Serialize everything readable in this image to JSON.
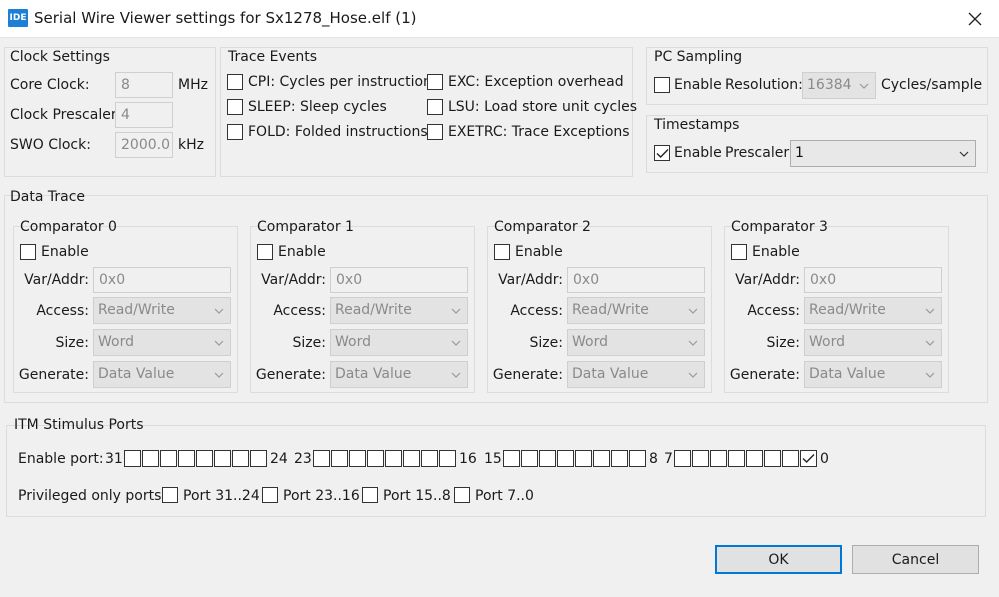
{
  "window": {
    "icon_text": "IDE",
    "title": "Serial Wire Viewer settings for Sx1278_Hose.elf (1)"
  },
  "clock_settings": {
    "title": "Clock Settings",
    "core_clock": {
      "label": "Core Clock:",
      "value": "8",
      "unit": "MHz"
    },
    "clock_prescaler": {
      "label": "Clock Prescaler:",
      "value": "4"
    },
    "swo_clock": {
      "label": "SWO Clock:",
      "value": "2000.0",
      "unit": "kHz"
    }
  },
  "trace_events": {
    "title": "Trace Events",
    "items": [
      {
        "label": "CPI: Cycles per instruction",
        "checked": false
      },
      {
        "label": "SLEEP: Sleep cycles",
        "checked": false
      },
      {
        "label": "FOLD: Folded instructions",
        "checked": false
      },
      {
        "label": "EXC: Exception overhead",
        "checked": false
      },
      {
        "label": "LSU: Load store unit cycles",
        "checked": false
      },
      {
        "label": "EXETRC: Trace Exceptions",
        "checked": false
      }
    ]
  },
  "pc_sampling": {
    "title": "PC Sampling",
    "enable_label": "Enable",
    "enabled": false,
    "resolution_label": "Resolution:",
    "resolution_value": "16384",
    "resolution_unit": "Cycles/sample"
  },
  "timestamps": {
    "title": "Timestamps",
    "enable_label": "Enable",
    "enabled": true,
    "prescaler_label": "Prescaler:",
    "prescaler_value": "1"
  },
  "data_trace": {
    "title": "Data Trace",
    "field_labels": {
      "enable": "Enable",
      "var_addr": "Var/Addr:",
      "access": "Access:",
      "size": "Size:",
      "generate": "Generate:"
    },
    "comparators": [
      {
        "title": "Comparator 0",
        "enabled": false,
        "var_addr": "0x0",
        "access": "Read/Write",
        "size": "Word",
        "generate": "Data Value"
      },
      {
        "title": "Comparator 1",
        "enabled": false,
        "var_addr": "0x0",
        "access": "Read/Write",
        "size": "Word",
        "generate": "Data Value"
      },
      {
        "title": "Comparator 2",
        "enabled": false,
        "var_addr": "0x0",
        "access": "Read/Write",
        "size": "Word",
        "generate": "Data Value"
      },
      {
        "title": "Comparator 3",
        "enabled": false,
        "var_addr": "0x0",
        "access": "Read/Write",
        "size": "Word",
        "generate": "Data Value"
      }
    ]
  },
  "itm": {
    "title": "ITM Stimulus Ports",
    "enable_port_label": "Enable port:",
    "port_groups": [
      {
        "high": "31",
        "low": "24",
        "checked": [
          false,
          false,
          false,
          false,
          false,
          false,
          false,
          false
        ]
      },
      {
        "high": "23",
        "low": "16",
        "checked": [
          false,
          false,
          false,
          false,
          false,
          false,
          false,
          false
        ]
      },
      {
        "high": "15",
        "low": "8",
        "checked": [
          false,
          false,
          false,
          false,
          false,
          false,
          false,
          false
        ]
      },
      {
        "high": "7",
        "low": "0",
        "checked": [
          false,
          false,
          false,
          false,
          false,
          false,
          false,
          true
        ]
      }
    ],
    "privileged_label": "Privileged only ports:",
    "privileged": [
      {
        "label": "Port 31..24",
        "checked": false
      },
      {
        "label": "Port 23..16",
        "checked": false
      },
      {
        "label": "Port 15..8",
        "checked": false
      },
      {
        "label": "Port 7..0",
        "checked": false
      }
    ]
  },
  "buttons": {
    "ok": "OK",
    "cancel": "Cancel"
  },
  "icons": {
    "check": "check-icon",
    "chevron": "chevron-down-icon",
    "close": "close-icon"
  }
}
